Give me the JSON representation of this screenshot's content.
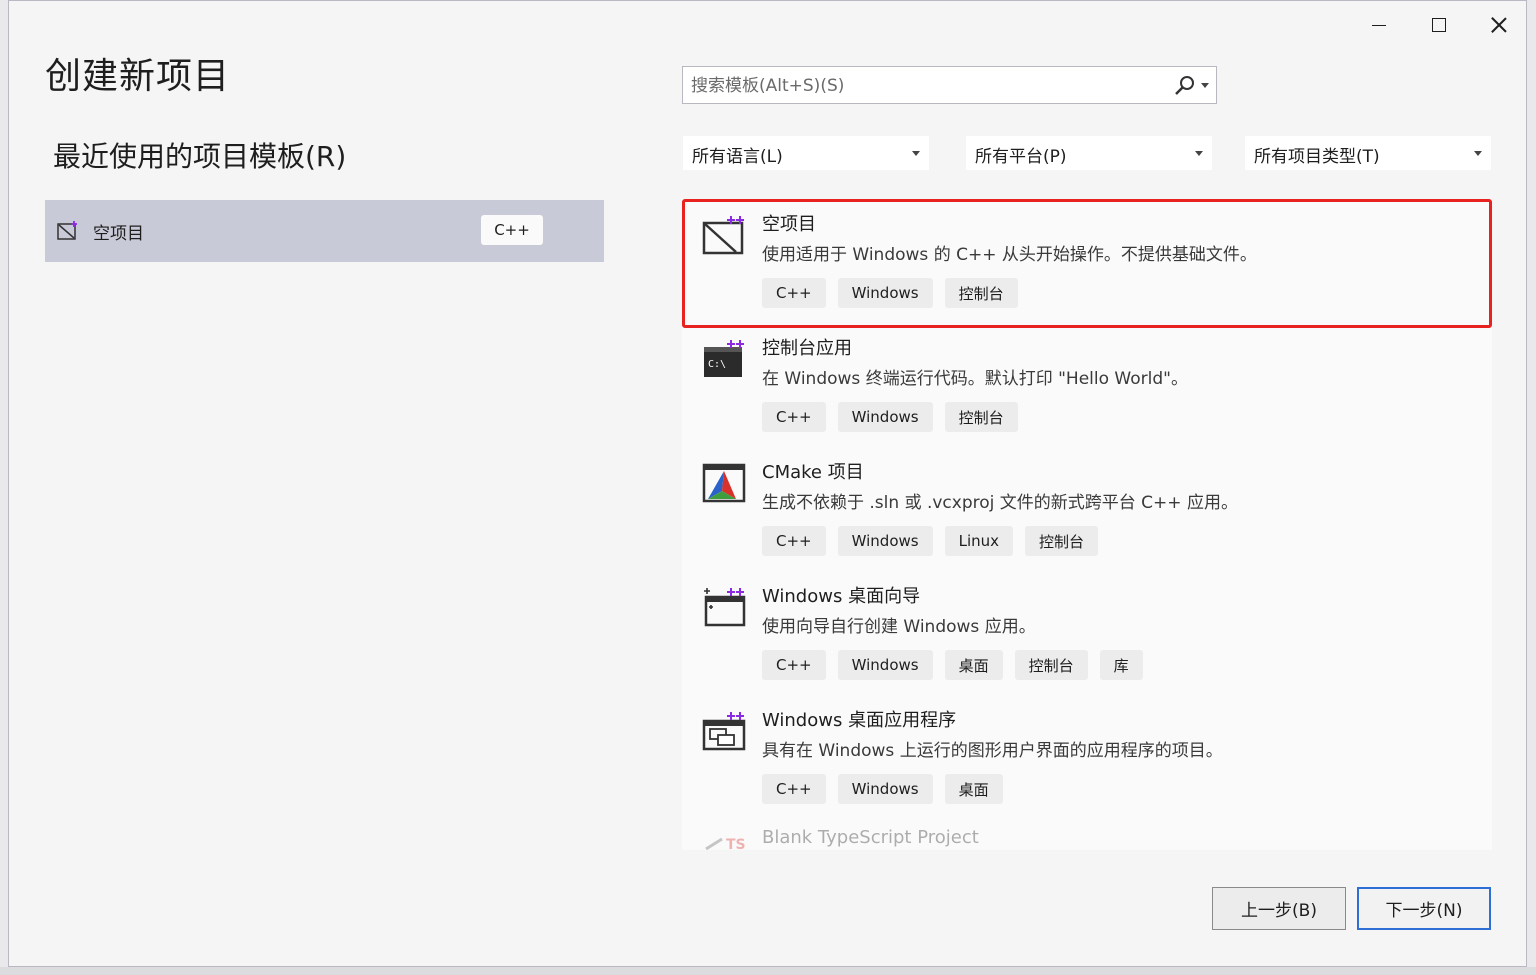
{
  "window": {
    "title": "创建新项目",
    "controls": [
      "minimize",
      "maximize",
      "close"
    ]
  },
  "recent": {
    "heading": "最近使用的项目模板(R)",
    "items": [
      {
        "label": "空项目",
        "tag": "C++",
        "icon": "empty-project-icon"
      }
    ]
  },
  "search": {
    "placeholder": "搜索模板(Alt+S)(S)",
    "value": ""
  },
  "filters": {
    "language": "所有语言(L)",
    "platform": "所有平台(P)",
    "project_type": "所有项目类型(T)"
  },
  "templates": [
    {
      "title": "空项目",
      "description": "使用适用于 Windows 的 C++ 从头开始操作。不提供基础文件。",
      "tags": [
        "C++",
        "Windows",
        "控制台"
      ],
      "icon": "empty-project-icon",
      "selected": true
    },
    {
      "title": "控制台应用",
      "description": "在 Windows 终端运行代码。默认打印 \"Hello World\"。",
      "tags": [
        "C++",
        "Windows",
        "控制台"
      ],
      "icon": "console-app-icon"
    },
    {
      "title": "CMake 项目",
      "description": "生成不依赖于 .sln 或 .vcxproj 文件的新式跨平台 C++ 应用。",
      "tags": [
        "C++",
        "Windows",
        "Linux",
        "控制台"
      ],
      "icon": "cmake-icon"
    },
    {
      "title": "Windows 桌面向导",
      "description": "使用向导自行创建 Windows 应用。",
      "tags": [
        "C++",
        "Windows",
        "桌面",
        "控制台",
        "库"
      ],
      "icon": "desktop-wizard-icon"
    },
    {
      "title": "Windows 桌面应用程序",
      "description": "具有在 Windows 上运行的图形用户界面的应用程序的项目。",
      "tags": [
        "C++",
        "Windows",
        "桌面"
      ],
      "icon": "desktop-app-icon"
    },
    {
      "title": "Blank TypeScript Project",
      "icon": "typescript-icon"
    }
  ],
  "buttons": {
    "back": "上一步(B)",
    "next": "下一步(N)"
  },
  "colors": {
    "selection_outline": "#e8231f",
    "recent_selected_bg": "#c9cad8",
    "primary_button_border": "#2e6fd6"
  }
}
